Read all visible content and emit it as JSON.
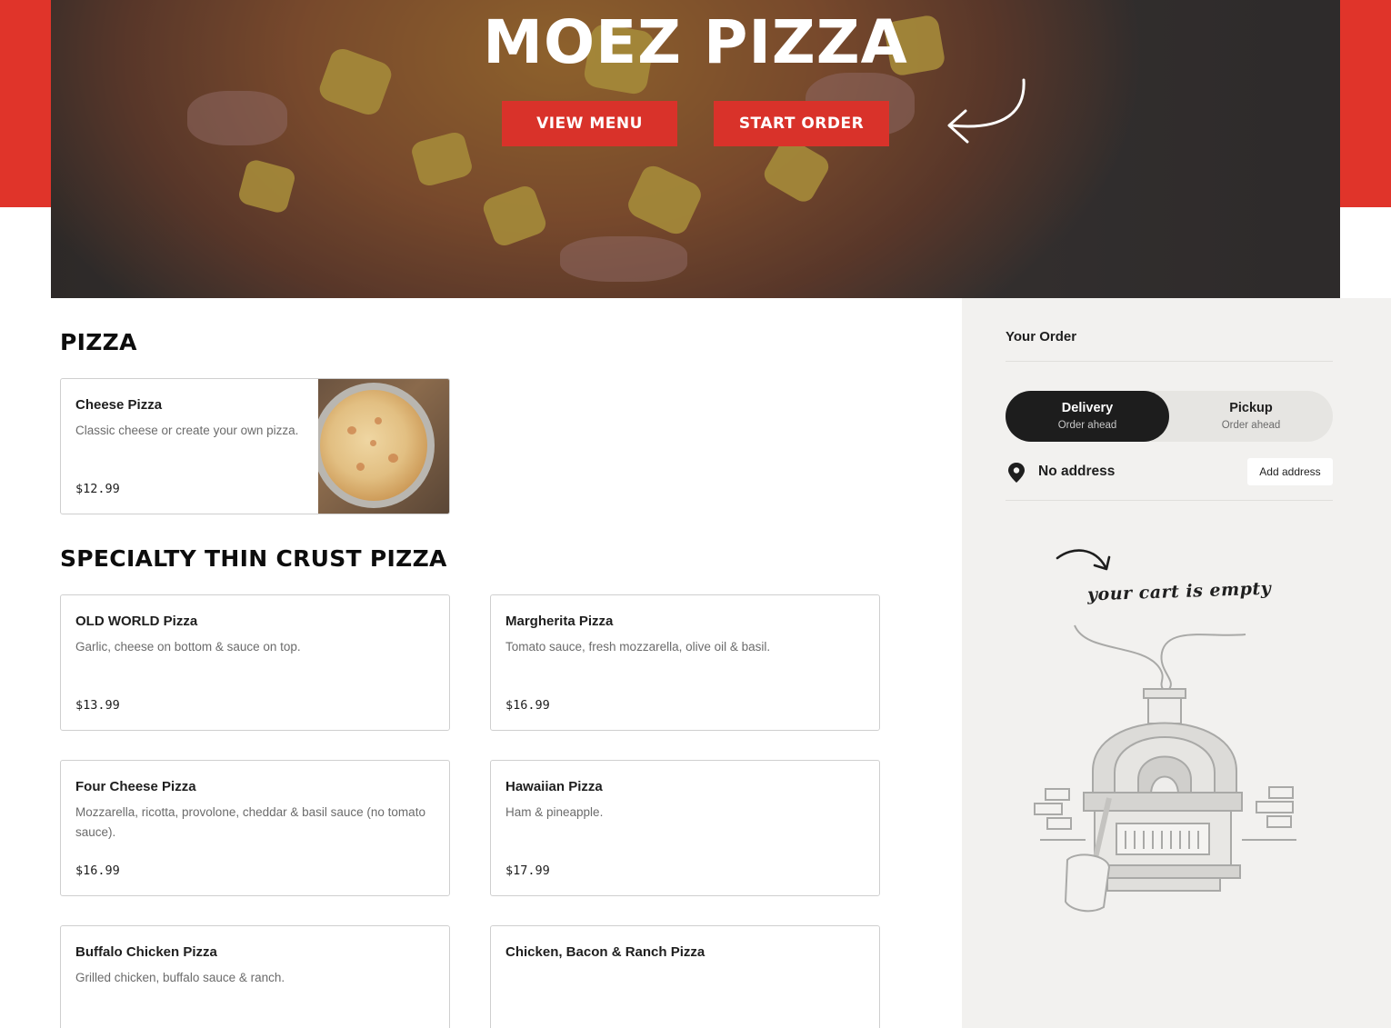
{
  "hero": {
    "title": "MOEZ PIZZA",
    "view_menu_label": "VIEW MENU",
    "start_order_label": "START ORDER"
  },
  "menu": {
    "sections": [
      {
        "title": "PIZZA",
        "items": [
          {
            "name": "Cheese Pizza",
            "description": "Classic cheese or create your own pizza.",
            "price": "$12.99",
            "has_image": true
          }
        ]
      },
      {
        "title": "SPECIALTY THIN CRUST PIZZA",
        "items": [
          {
            "name": "OLD WORLD Pizza",
            "description": "Garlic, cheese on bottom & sauce on top.",
            "price": "$13.99"
          },
          {
            "name": "Margherita Pizza",
            "description": "Tomato sauce, fresh mozzarella, olive oil & basil.",
            "price": "$16.99"
          },
          {
            "name": "Four Cheese Pizza",
            "description": "Mozzarella, ricotta, provolone, cheddar & basil sauce (no tomato sauce).",
            "price": "$16.99"
          },
          {
            "name": "Hawaiian Pizza",
            "description": "Ham & pineapple.",
            "price": "$17.99"
          },
          {
            "name": "Buffalo Chicken Pizza",
            "description": "Grilled chicken, buffalo sauce & ranch.",
            "price": ""
          },
          {
            "name": "Chicken, Bacon & Ranch Pizza",
            "description": "",
            "price": ""
          }
        ]
      }
    ]
  },
  "order": {
    "title": "Your Order",
    "delivery": {
      "label": "Delivery",
      "sub": "Order ahead",
      "selected": true
    },
    "pickup": {
      "label": "Pickup",
      "sub": "Order ahead",
      "selected": false
    },
    "address_text": "No address",
    "add_address_label": "Add address",
    "empty_cart_text": "your cart is empty"
  },
  "colors": {
    "brand_red": "#e0342a",
    "button_red": "#d9322a",
    "sidebar_bg": "#f2f1ef",
    "toggle_selected": "#1d1d1d"
  },
  "icons": {
    "address": "map-pin-icon",
    "hero_arrow": "curved-arrow-icon",
    "cart_arrow": "hand-drawn-arrow-icon",
    "empty_illustration": "pizza-oven-illustration"
  }
}
